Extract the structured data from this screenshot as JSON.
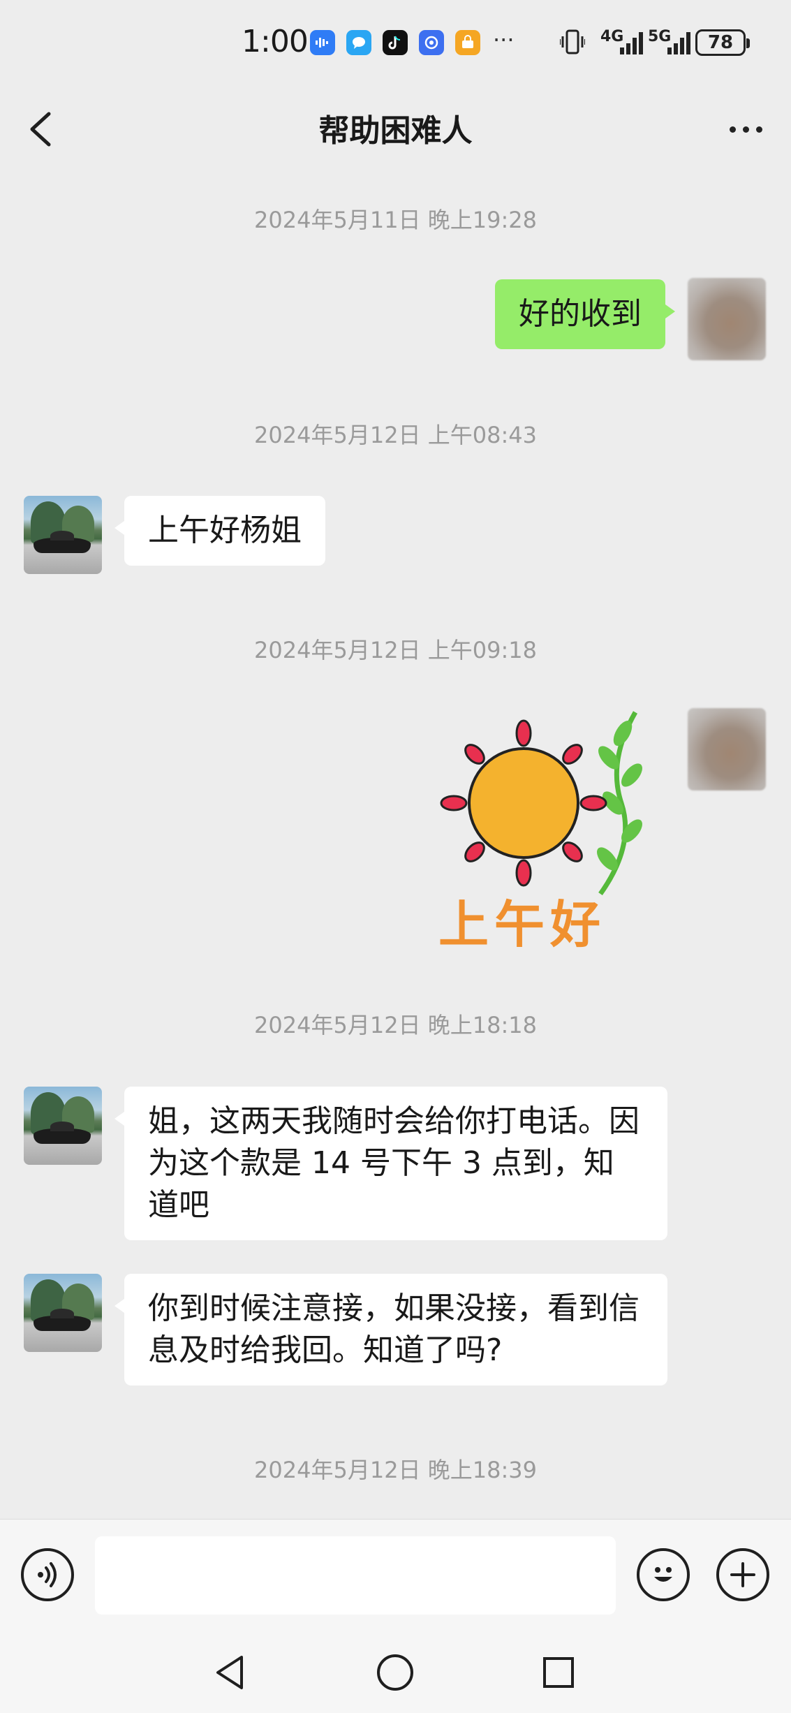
{
  "status_bar": {
    "time": "1:00",
    "more": "···",
    "network_1": "4G",
    "network_2": "5G",
    "battery": "78"
  },
  "header": {
    "title": "帮助困难人"
  },
  "messages": [
    {
      "type": "timestamp",
      "text": "2024年5月11日 晚上19:28"
    },
    {
      "type": "text",
      "side": "right",
      "text": "好的收到"
    },
    {
      "type": "timestamp",
      "text": "2024年5月12日 上午08:43"
    },
    {
      "type": "text",
      "side": "left",
      "text": "上午好杨姐"
    },
    {
      "type": "timestamp",
      "text": "2024年5月12日 上午09:18"
    },
    {
      "type": "sticker",
      "side": "right",
      "text": "上午好",
      "icon": "sun-sticker"
    },
    {
      "type": "timestamp",
      "text": "2024年5月12日 晚上18:18"
    },
    {
      "type": "text",
      "side": "left",
      "text": "姐，这两天我随时会给你打电话。因为这个款是 14 号下午 3 点到，知道吧"
    },
    {
      "type": "text",
      "side": "left",
      "text": "你到时候注意接，如果没接，看到信息及时给我回。知道了吗?"
    },
    {
      "type": "timestamp",
      "text": "2024年5月12日 晚上18:39"
    }
  ],
  "input_bar": {
    "voice_icon": "voice-icon",
    "emoji_icon": "emoji-icon",
    "plus_icon": "plus-icon",
    "value": ""
  },
  "colors": {
    "background": "#ededed",
    "sent_bubble": "#95ec69",
    "received_bubble": "#ffffff"
  }
}
